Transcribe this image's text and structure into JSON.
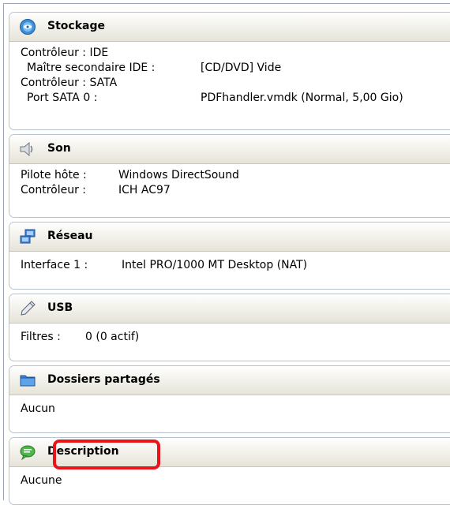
{
  "sections": {
    "storage": {
      "title": "Stockage",
      "rows": [
        {
          "label": "Contrôleur : IDE",
          "value": ""
        },
        {
          "label": "Maître secondaire IDE :",
          "value": "[CD/DVD] Vide"
        },
        {
          "label": "Contrôleur : SATA",
          "value": ""
        },
        {
          "label": "Port SATA 0 :",
          "value": "PDFhandler.vmdk (Normal, 5,00 Gio)"
        }
      ]
    },
    "audio": {
      "title": "Son",
      "rows": [
        {
          "label": "Pilote hôte :",
          "value": "Windows DirectSound"
        },
        {
          "label": "Contrôleur :",
          "value": "ICH AC97"
        }
      ]
    },
    "network": {
      "title": "Réseau",
      "rows": [
        {
          "label": "Interface 1 :",
          "value": "Intel PRO/1000 MT Desktop (NAT)"
        }
      ]
    },
    "usb": {
      "title": "USB",
      "rows": [
        {
          "label": "Filtres :",
          "value": "0 (0 actif)"
        }
      ]
    },
    "shared_folders": {
      "title": "Dossiers partagés",
      "rows": [
        {
          "label": "Aucun",
          "value": ""
        }
      ]
    },
    "description": {
      "title": "Description",
      "rows": [
        {
          "label": "Aucune",
          "value": ""
        }
      ]
    }
  },
  "icons": {
    "storage": "disk-icon",
    "audio": "speaker-icon",
    "network": "network-icon",
    "usb": "usb-pen-icon",
    "shared_folders": "folder-icon",
    "description": "speech-bubble-icon"
  },
  "colors": {
    "highlight": "#e8141a",
    "header_gradient_top": "#ffffff",
    "header_gradient_bottom": "#e6e4d9",
    "border": "#b9c3ce"
  }
}
